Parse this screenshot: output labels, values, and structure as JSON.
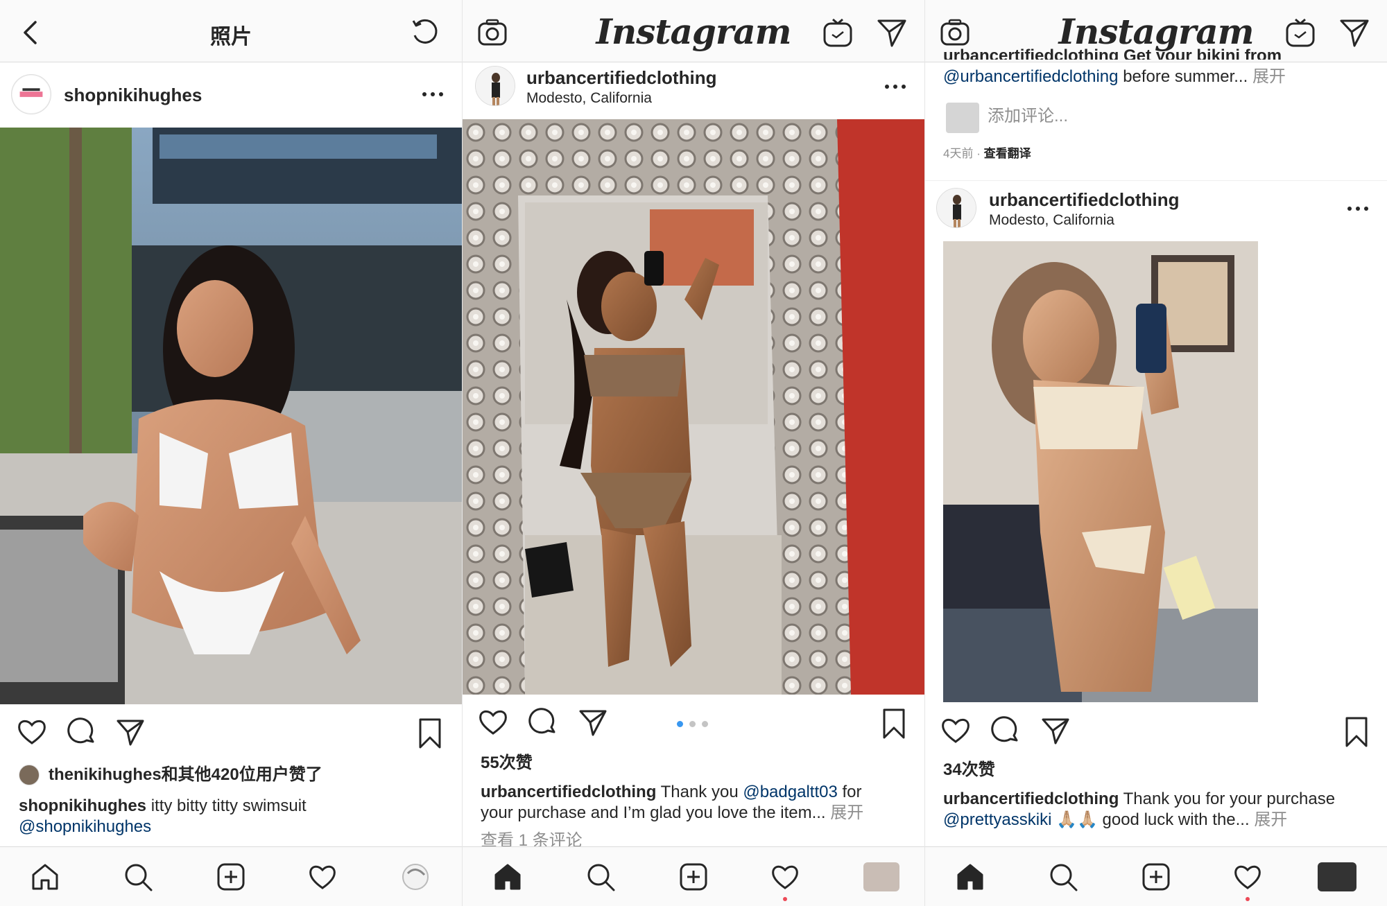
{
  "panel1": {
    "header_title": "照片",
    "post": {
      "username": "shopnikihughes",
      "avatar_text": "SHOP nikihughes"
    },
    "likes_text": "thenikihughes和其他420位用户赞了",
    "caption_user": "shopnikihughes",
    "caption_text": "itty bitty titty swimsuit",
    "caption_mention": "@shopnikihughes"
  },
  "panel2": {
    "logo": "Instagram",
    "post": {
      "username": "urbancertifiedclothing",
      "location": "Modesto, California"
    },
    "likes_text": "55次赞",
    "caption_user": "urbancertifiedclothing",
    "caption_text1": "Thank you",
    "caption_mention": "@badgaltt03",
    "caption_text2": "for",
    "caption_line2": "your purchase and I’m glad you love the item...",
    "expand_label": "展开",
    "view_comments": "查看 1 条评论"
  },
  "panel3": {
    "logo": "Instagram",
    "prev_caption_top": "urbancertifiedclothing Get your bikini from",
    "prev_caption_mention": "@urbancertifiedclothing",
    "prev_caption_rest": "before summer...",
    "expand_label": "展开",
    "add_comment_placeholder": "添加评论...",
    "time_ago": "4天前",
    "see_translation": "查看翻译",
    "post": {
      "username": "urbancertifiedclothing",
      "location": "Modesto, California"
    },
    "likes_text": "34次赞",
    "caption_user": "urbancertifiedclothing",
    "caption_text": "Thank you for your purchase",
    "caption_mention": "@prettyasskiki",
    "caption_emoji": "🙏🏼🙏🏼",
    "caption_rest": "good luck with the...",
    "expand_label2": "展开"
  },
  "colors": {
    "mention": "#003569",
    "muted": "#8e8e8e",
    "active_dot": "#3897f0",
    "notify_dot": "#ed4956"
  },
  "icons": [
    "back-icon",
    "refresh-icon",
    "camera-icon",
    "igtv-icon",
    "direct-icon",
    "more-icon",
    "heart-icon",
    "comment-icon",
    "share-icon",
    "bookmark-icon",
    "home-icon",
    "search-icon",
    "add-icon",
    "activity-icon",
    "profile-icon"
  ]
}
